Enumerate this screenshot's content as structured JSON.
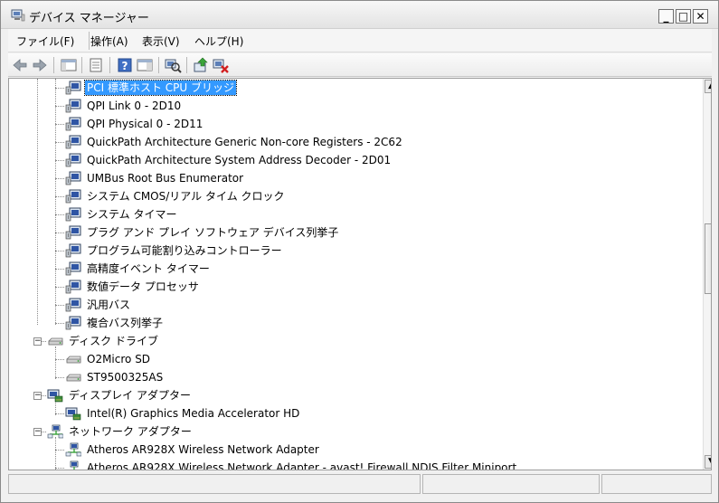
{
  "window": {
    "title": "デバイス マネージャー"
  },
  "title_buttons": {
    "minimize": "_",
    "maximize": "□",
    "close": "✕"
  },
  "menu": [
    {
      "label": "ファイル(F)"
    },
    {
      "label": "操作(A)"
    },
    {
      "label": "表示(V)"
    },
    {
      "label": "ヘルプ(H)"
    }
  ],
  "toolbar": {
    "buttons": [
      "back-icon",
      "forward-icon",
      "show-hide-tree-icon",
      "properties-icon",
      "help-icon",
      "action-pane-icon",
      "scan-hardware-icon",
      "update-driver-icon",
      "uninstall-icon"
    ]
  },
  "tree": {
    "rows": [
      {
        "label": "PCI 標準ホスト CPU ブリッジ",
        "icon": "system-device-icon",
        "selected": true
      },
      {
        "label": "QPI Link 0 - 2D10",
        "icon": "system-device-icon"
      },
      {
        "label": "QPI Physical 0 - 2D11",
        "icon": "system-device-icon"
      },
      {
        "label": "QuickPath Architecture Generic Non-core Registers - 2C62",
        "icon": "system-device-icon"
      },
      {
        "label": "QuickPath Architecture System Address Decoder - 2D01",
        "icon": "system-device-icon"
      },
      {
        "label": "UMBus Root Bus Enumerator",
        "icon": "system-device-icon"
      },
      {
        "label": "システム CMOS/リアル タイム クロック",
        "icon": "system-device-icon"
      },
      {
        "label": "システム タイマー",
        "icon": "system-device-icon"
      },
      {
        "label": "プラグ アンド プレイ ソフトウェア デバイス列挙子",
        "icon": "system-device-icon"
      },
      {
        "label": "プログラム可能割り込みコントローラー",
        "icon": "system-device-icon"
      },
      {
        "label": "高精度イベント タイマー",
        "icon": "system-device-icon"
      },
      {
        "label": "数値データ プロセッサ",
        "icon": "system-device-icon"
      },
      {
        "label": "汎用バス",
        "icon": "system-device-icon"
      },
      {
        "label": "複合バス列挙子",
        "icon": "system-device-icon"
      },
      {
        "label": "ディスク ドライブ",
        "icon": "disk-drive-icon",
        "category": true
      },
      {
        "label": "O2Micro SD",
        "icon": "disk-drive-icon"
      },
      {
        "label": "ST9500325AS",
        "icon": "disk-drive-icon"
      },
      {
        "label": "ディスプレイ アダプター",
        "icon": "display-adapter-icon",
        "category": true
      },
      {
        "label": "Intel(R) Graphics Media Accelerator HD",
        "icon": "display-adapter-icon"
      },
      {
        "label": "ネットワーク アダプター",
        "icon": "network-adapter-icon",
        "category": true
      },
      {
        "label": "Atheros AR928X Wireless Network Adapter",
        "icon": "network-adapter-icon"
      },
      {
        "label": "Atheros AR928X Wireless Network Adapter - avast! Firewall NDIS Filter Miniport",
        "icon": "network-adapter-icon"
      }
    ]
  },
  "scrollbar": {
    "up": "▲",
    "down": "▼"
  },
  "colors": {
    "selection": "#3399ff",
    "window_bg": "#f0f0f0"
  }
}
